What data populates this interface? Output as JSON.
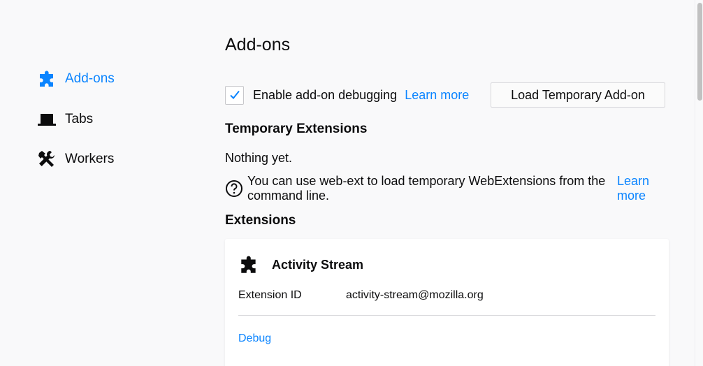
{
  "sidebar": {
    "items": [
      {
        "label": "Add-ons",
        "icon": "puzzle-icon",
        "active": true
      },
      {
        "label": "Tabs",
        "icon": "tab-icon",
        "active": false
      },
      {
        "label": "Workers",
        "icon": "hammer-wrench-icon",
        "active": false
      }
    ]
  },
  "main": {
    "title": "Add-ons",
    "debugging": {
      "checked": true,
      "label": "Enable add-on debugging",
      "learn_more": "Learn more",
      "load_button": "Load Temporary Add-on"
    },
    "temporary": {
      "heading": "Temporary Extensions",
      "empty_text": "Nothing yet.",
      "tip_icon": "help-icon",
      "tip_text": "You can use web-ext to load temporary WebExtensions from the command line.",
      "tip_link": "Learn more"
    },
    "extensions": {
      "heading": "Extensions",
      "items": [
        {
          "name": "Activity Stream",
          "icon": "puzzle-icon",
          "id_label": "Extension ID",
          "id_value": "activity-stream@mozilla.org",
          "action": "Debug"
        }
      ]
    }
  },
  "colors": {
    "accent": "#0a84ff",
    "background": "#f9f9fa",
    "text": "#0c0c0d"
  }
}
